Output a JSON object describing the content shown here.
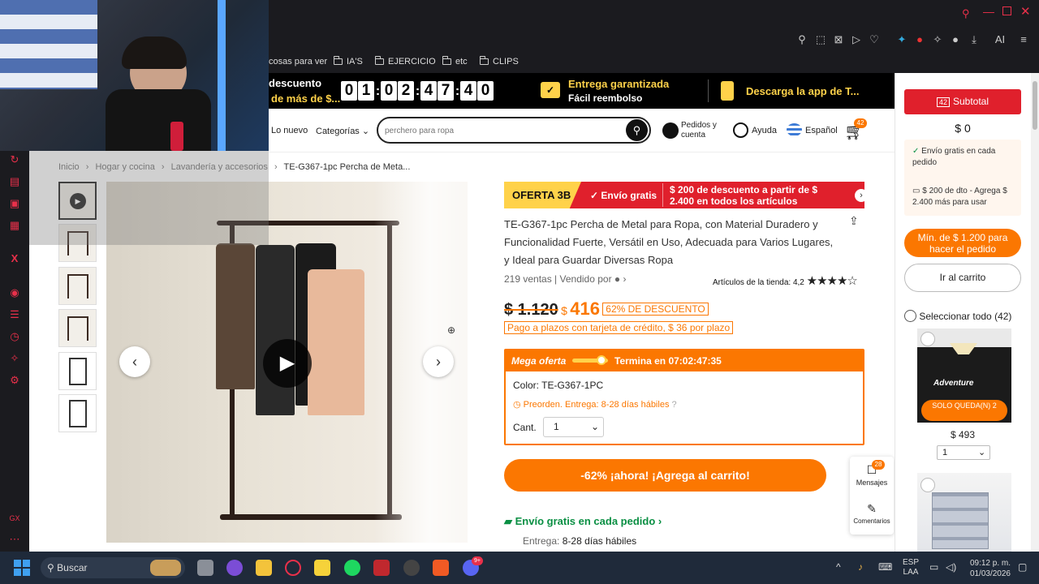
{
  "bookmarks": [
    {
      "label": "cosas para ver"
    },
    {
      "label": "IA'S"
    },
    {
      "label": "EJERCICIO"
    },
    {
      "label": "etc"
    },
    {
      "label": "CLIPS"
    }
  ],
  "toolbar": {
    "ai_label": "AI"
  },
  "promo": {
    "left_title": "descuento",
    "left_sub": "de más de $...",
    "countdown": [
      "0",
      "1",
      "0",
      "2",
      "4",
      "7",
      "4",
      "0"
    ],
    "delivery_title": "Entrega garantizada",
    "delivery_sub": "Fácil reembolso",
    "app_text": "Descarga la app de T..."
  },
  "nav": {
    "new_label": "Lo nuevo",
    "categories_label": "Categorías",
    "search_placeholder": "perchero para ropa",
    "orders_label": "Pedidos y cuenta",
    "help_label": "Ayuda",
    "language_label": "Español",
    "cart_count": "42"
  },
  "breadcrumb": {
    "items": [
      "Inicio",
      "Hogar y cocina",
      "Lavandería y accesorios",
      "TE-G367-1pc Percha de Meta..."
    ]
  },
  "banner": {
    "badge": "OFERTA 3B",
    "free_shipping": "Envío gratis",
    "discount_line1": "$ 200 de descuento a partir de $",
    "discount_line2": "2.400 en todos los artículos"
  },
  "product": {
    "title": "TE-G367-1pc Percha de Metal para Ropa, con Material Duradero y Funcionalidad Fuerte, Versátil en Uso, Adecuada para Varios Lugares, y Ideal para Guardar Diversas Ropa",
    "sales": "219 ventas",
    "sold_by": "Vendido por",
    "store_rating_label": "Artículos de la tienda: 4,2",
    "rating": 4.2,
    "old_price": "$ 1.120",
    "price_symbol": "$",
    "price": "416",
    "discount_badge": "62% DE DESCUENTO",
    "installments": "Pago a plazos con tarjeta de crédito, $ 36 por plazo",
    "mega_offer": "Mega oferta",
    "ends_in": "Termina en 07:02:47:35",
    "color_label": "Color: TE-G367-1PC",
    "preorder": "Preorden. Entrega: 8-28 días hábiles",
    "qty_label": "Cant.",
    "qty_value": "1",
    "add_to_cart": "-62% ¡ahora! ¡Agrega al carrito!",
    "free_shipping_each": "Envío gratis en cada pedido",
    "delivery_label": "Entrega:",
    "delivery_range": "8-28 días hábiles"
  },
  "float": {
    "messages_count": "28",
    "messages_label": "Mensajes",
    "comments_label": "Comentarios"
  },
  "cart_panel": {
    "subtotal_count": "42",
    "subtotal_label": "Subtotal",
    "subtotal_value": "$ 0",
    "benefit1": "Envío gratis en cada pedido",
    "benefit2": "$ 200 de dto - Agrega $ 2.400 más para usar",
    "min_order": "Mín. de $ 1.200 para hacer el pedido",
    "go_cart": "Ir al carrito",
    "select_all": "Seleccionar todo (42)",
    "item1_badge": "SOLO QUEDA(N) 2",
    "item1_price": "$ 493",
    "item1_qty": "1",
    "item1_shirt_text": "Adventure"
  },
  "taskbar": {
    "search_label": "Buscar",
    "lang_top": "ESP",
    "lang_bottom": "LAA",
    "time": "09:12 p. m.",
    "date": "01/03/2026",
    "brave_badge": "9+"
  },
  "colors": {
    "accent": "#fb7701",
    "temu_red": "#e0202c",
    "dark": "#000000"
  }
}
